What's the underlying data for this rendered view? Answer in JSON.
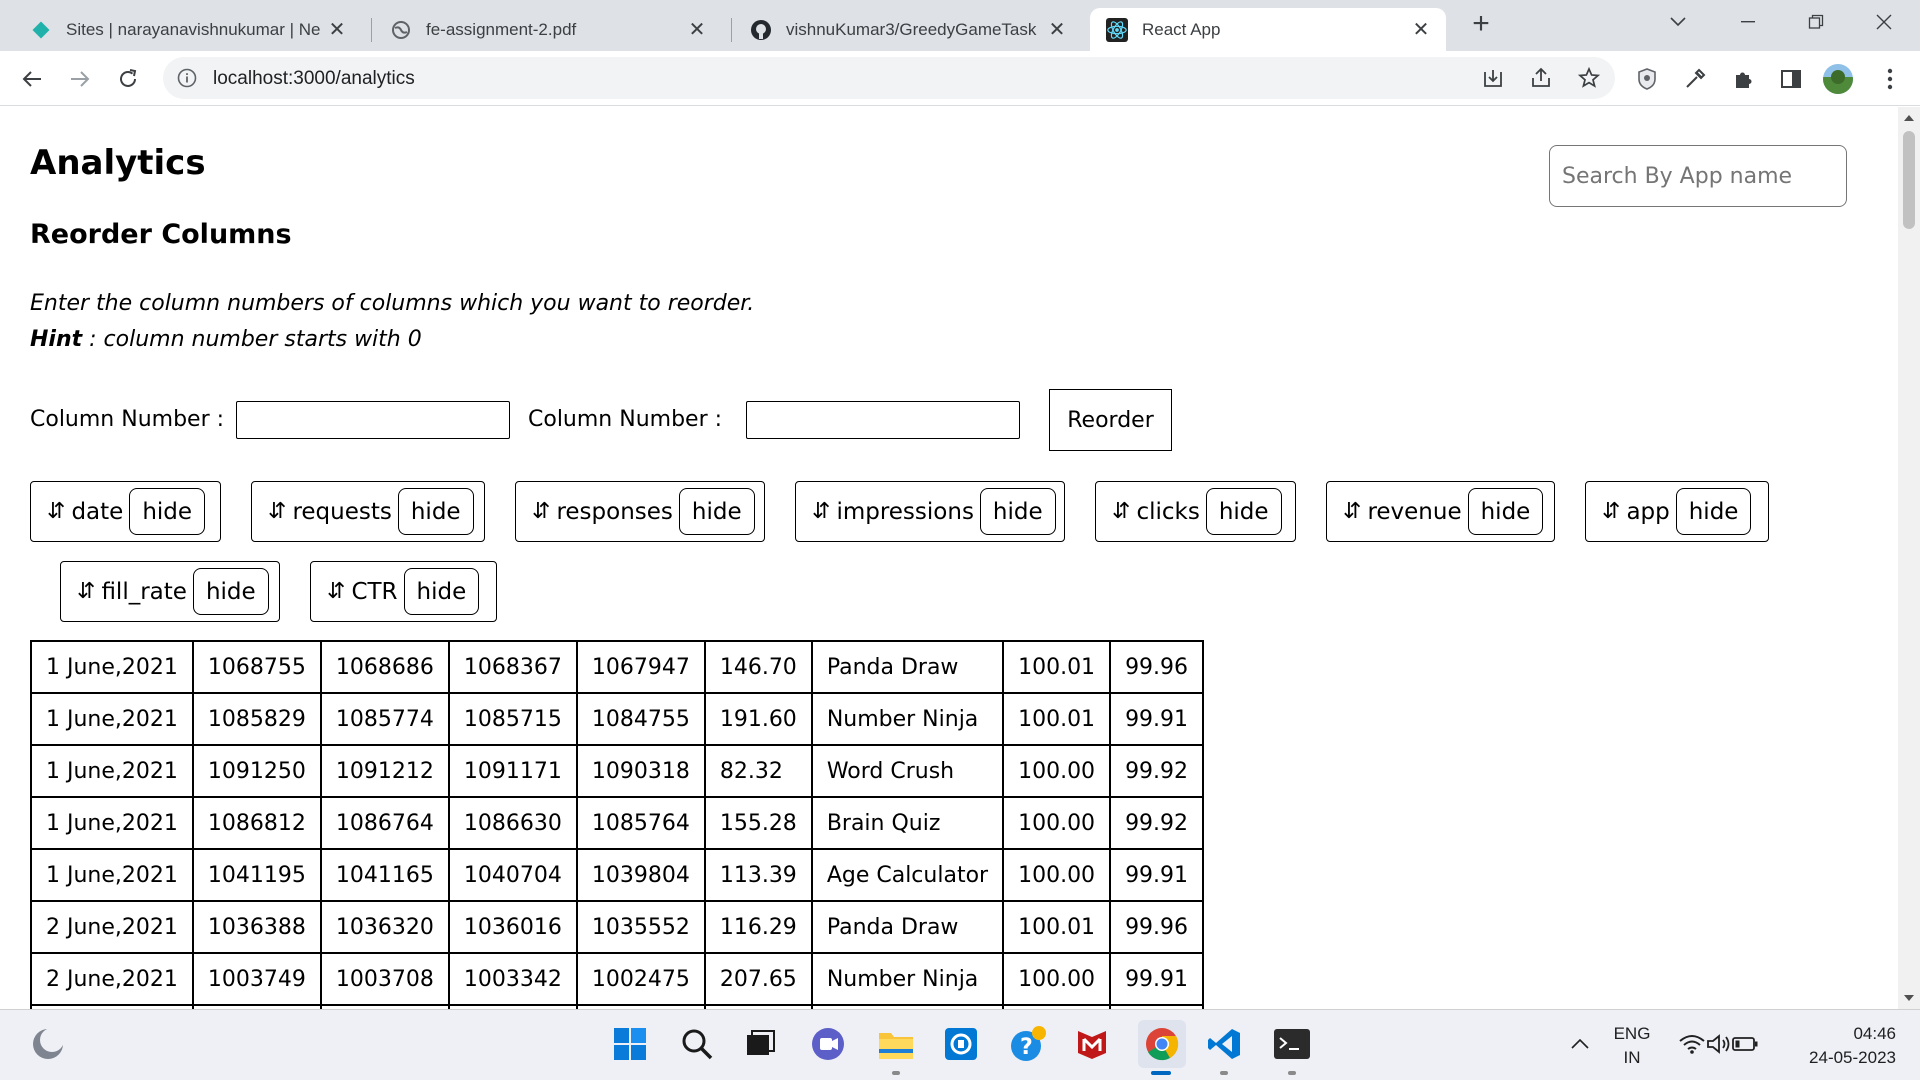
{
  "browser": {
    "tabs": [
      {
        "title": "Sites | narayanavishnukumar | Ne",
        "icon": "netlify-diamond-icon",
        "active": false
      },
      {
        "title": "fe-assignment-2.pdf",
        "icon": "globe-icon",
        "active": false
      },
      {
        "title": "vishnuKumar3/GreedyGameTask",
        "icon": "github-icon",
        "active": false
      },
      {
        "title": "React App",
        "icon": "react-icon",
        "active": true
      }
    ],
    "address": "localhost:3000/analytics"
  },
  "page": {
    "title": "Analytics",
    "search_placeholder": "Search By App name",
    "reorder_heading": "Reorder Columns",
    "instruction": "Enter the column numbers of columns which you want to reorder.",
    "hint_label": "Hint",
    "hint_text": " : column number starts with 0",
    "column_number_label": "Column Number :",
    "reorder_button": "Reorder",
    "sort_glyph": "⇵",
    "hide_label": "hide",
    "columns": [
      "date",
      "requests",
      "responses",
      "impressions",
      "clicks",
      "revenue",
      "app",
      "fill_rate",
      "CTR"
    ],
    "rows": [
      [
        "1 June,2021",
        "1068755",
        "1068686",
        "1068367",
        "1067947",
        "146.70",
        "Panda Draw",
        "100.01",
        "99.96"
      ],
      [
        "1 June,2021",
        "1085829",
        "1085774",
        "1085715",
        "1084755",
        "191.60",
        "Number Ninja",
        "100.01",
        "99.91"
      ],
      [
        "1 June,2021",
        "1091250",
        "1091212",
        "1091171",
        "1090318",
        "82.32",
        "Word Crush",
        "100.00",
        "99.92"
      ],
      [
        "1 June,2021",
        "1086812",
        "1086764",
        "1086630",
        "1085764",
        "155.28",
        "Brain Quiz",
        "100.00",
        "99.92"
      ],
      [
        "1 June,2021",
        "1041195",
        "1041165",
        "1040704",
        "1039804",
        "113.39",
        "Age Calculator",
        "100.00",
        "99.91"
      ],
      [
        "2 June,2021",
        "1036388",
        "1036320",
        "1036016",
        "1035552",
        "116.29",
        "Panda Draw",
        "100.01",
        "99.96"
      ],
      [
        "2 June,2021",
        "1003749",
        "1003708",
        "1003342",
        "1002475",
        "207.65",
        "Number Ninja",
        "100.00",
        "99.91"
      ]
    ]
  },
  "taskbar": {
    "lang_1": "ENG",
    "lang_2": "IN",
    "time": "04:46",
    "date": "24-05-2023"
  }
}
